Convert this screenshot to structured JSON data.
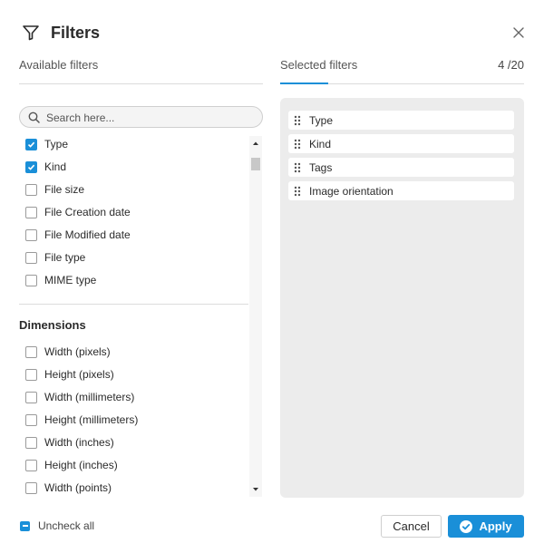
{
  "header": {
    "title": "Filters",
    "filter_icon": "funnel-icon",
    "close_icon": "close-icon"
  },
  "available": {
    "heading": "Available filters",
    "search_placeholder": "Search here...",
    "search_value": "",
    "items": [
      {
        "label": "Type",
        "checked": true
      },
      {
        "label": "Kind",
        "checked": true
      },
      {
        "label": "File size",
        "checked": false
      },
      {
        "label": "File Creation date",
        "checked": false
      },
      {
        "label": "File Modified date",
        "checked": false
      },
      {
        "label": "File type",
        "checked": false
      },
      {
        "label": "MIME type",
        "checked": false
      }
    ],
    "sections": [
      {
        "title": "Dimensions",
        "items": [
          {
            "label": "Width (pixels)",
            "checked": false
          },
          {
            "label": "Height (pixels)",
            "checked": false
          },
          {
            "label": "Width (millimeters)",
            "checked": false
          },
          {
            "label": "Height (millimeters)",
            "checked": false
          },
          {
            "label": "Width (inches)",
            "checked": false
          },
          {
            "label": "Height (inches)",
            "checked": false
          },
          {
            "label": "Width (points)",
            "checked": false
          }
        ]
      }
    ]
  },
  "selected": {
    "heading": "Selected filters",
    "count": "4 /20",
    "items": [
      "Type",
      "Kind",
      "Tags",
      "Image orientation"
    ]
  },
  "footer": {
    "uncheck_all_label": "Uncheck all",
    "cancel_label": "Cancel",
    "apply_label": "Apply"
  },
  "colors": {
    "accent": "#1a8fd8",
    "panel_bg": "#ececec"
  }
}
